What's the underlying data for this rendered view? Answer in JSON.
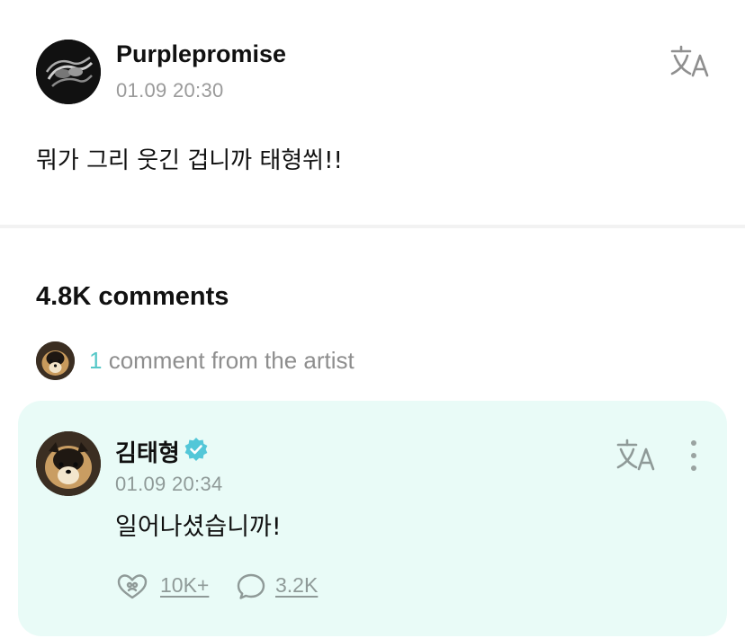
{
  "post": {
    "author": "Purplepromise",
    "timestamp": "01.09 20:30",
    "body": "뭐가 그리 웃긴 겁니까 태형쒸!!",
    "translate_icon": "translate-icon"
  },
  "comments": {
    "count_label": "4.8K comments",
    "artist_summary": {
      "count": "1",
      "label": " comment from the artist"
    }
  },
  "artist_comment": {
    "author": "김태형",
    "verified_icon": "verified-badge-icon",
    "timestamp": "01.09 20:34",
    "body": "일어나셨습니까!",
    "likes": "10K+",
    "replies": "3.2K",
    "like_icon": "heart-paw-icon",
    "reply_icon": "speech-bubble-icon",
    "more_icon": "more-vertical-icon"
  },
  "colors": {
    "accent": "#56c8c8",
    "card_background": "#e9fbf7",
    "muted_text": "#9a9a9a"
  }
}
